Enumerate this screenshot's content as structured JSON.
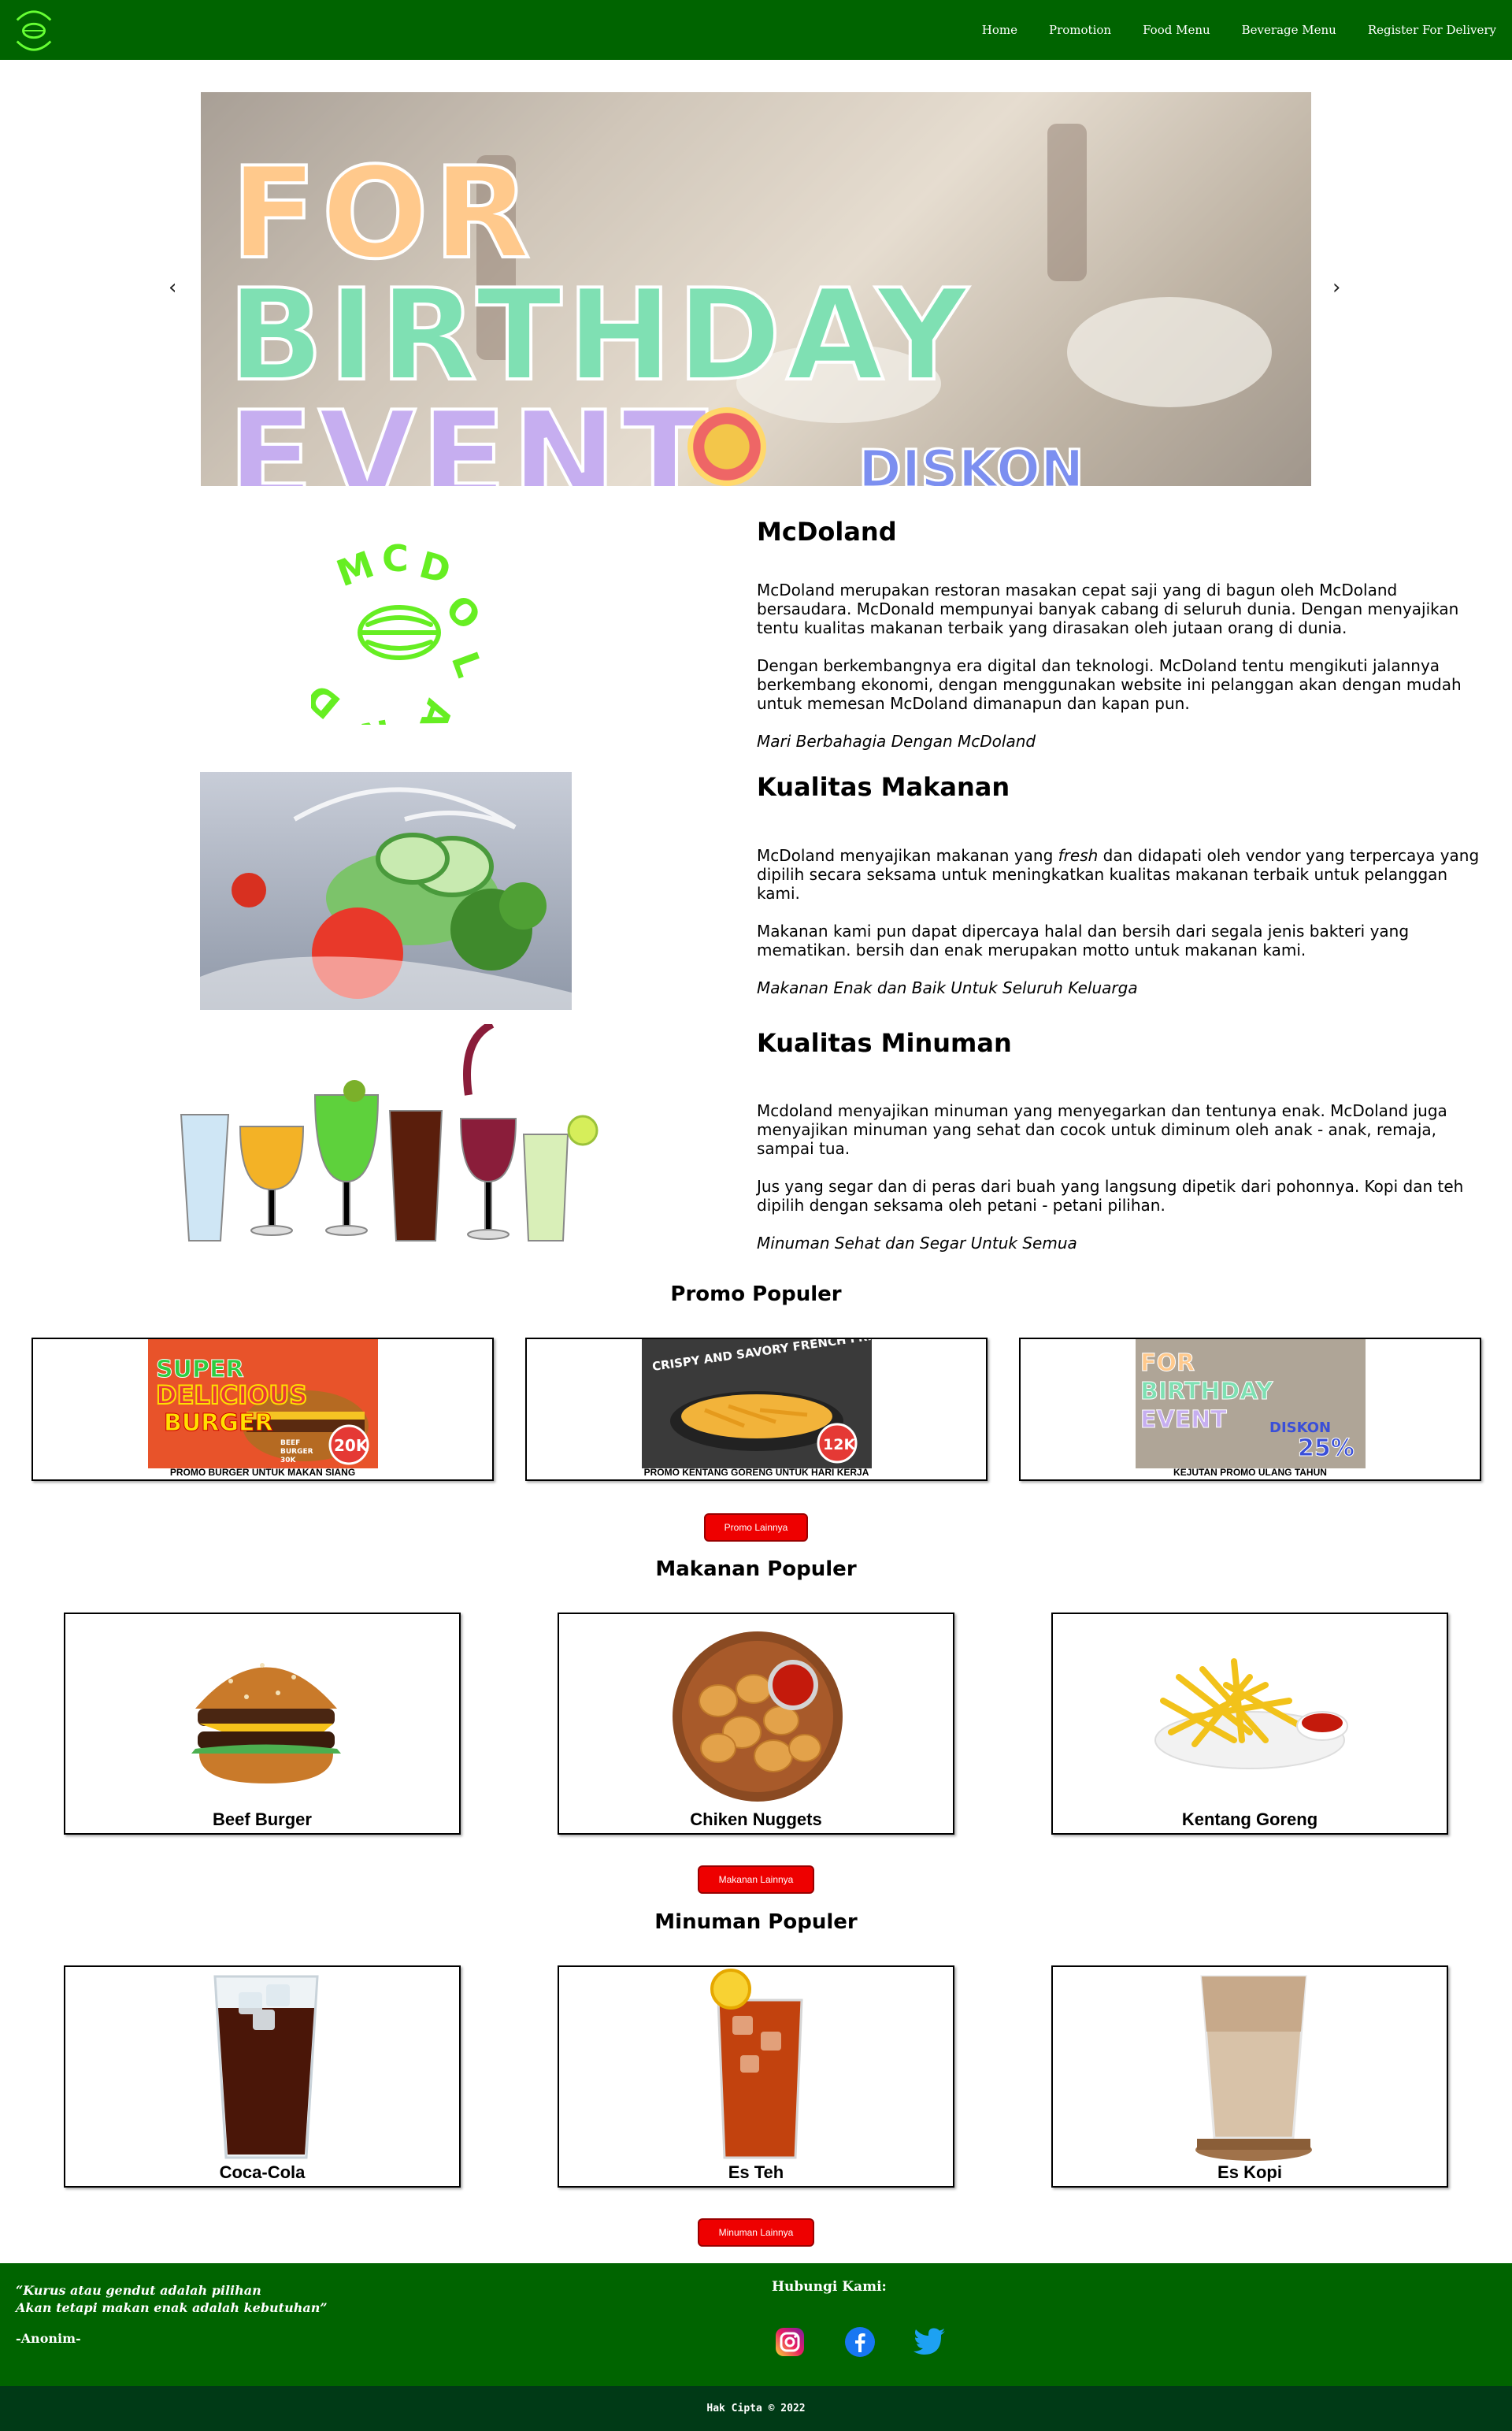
{
  "nav": {
    "logo_alt": "McDoland",
    "links": [
      "Home",
      "Promotion",
      "Food Menu",
      "Beverage Menu",
      "Register For Delivery"
    ]
  },
  "hero": {
    "prev": "‹",
    "next": "›",
    "line1": "FOR",
    "line2": "BIRTHDAY",
    "line3": "EVENT",
    "diskon": "DISKON"
  },
  "about": [
    {
      "title": "McDoland",
      "paragraphs": [
        "McDoland merupakan restoran masakan cepat saji yang di bagun oleh McDoland bersaudara. McDonald mempunyai banyak cabang di seluruh dunia. Dengan menyajikan tentu kualitas makanan terbaik yang dirasakan oleh jutaan orang di dunia.",
        "Dengan berkembangnya era digital dan teknologi. McDoland tentu mengikuti jalannya berkembang ekonomi, dengan menggunakan website ini pelanggan akan dengan mudah untuk memesan McDoland dimanapun dan kapan pun."
      ],
      "tagline": "Mari Berbahagia Dengan McDoland"
    },
    {
      "title": "Kualitas Makanan",
      "p1_before": "McDoland menyajikan makanan yang ",
      "p1_em": "fresh",
      "p1_after": " dan didapati oleh vendor yang terpercaya yang dipilih secara seksama untuk meningkatkan kualitas makanan terbaik untuk pelanggan kami.",
      "p2": "Makanan kami pun dapat dipercaya halal dan bersih dari segala jenis bakteri yang mematikan. bersih dan enak merupakan motto untuk makanan kami.",
      "tagline": "Makanan Enak dan Baik Untuk Seluruh Keluarga"
    },
    {
      "title": "Kualitas Minuman",
      "paragraphs": [
        "Mcdoland menyajikan minuman yang menyegarkan dan tentunya enak. McDoland juga menyajikan minuman yang sehat dan cocok untuk diminum oleh anak - anak, remaja, sampai tua.",
        "Jus yang segar dan di peras dari buah yang langsung dipetik dari pohonnya. Kopi dan teh dipilih dengan seksama oleh petani - petani pilihan."
      ],
      "tagline": "Minuman Sehat dan Segar Untuk Semua"
    }
  ],
  "promo": {
    "title": "Promo Populer",
    "items": [
      {
        "caption": "PROMO BURGER UNTUK MAKAN SIANG",
        "banner_l1": "SUPER",
        "banner_l2": "DELICIOUS",
        "banner_l3": "BURGER",
        "price": "20K",
        "sub1": "BEEF",
        "sub2": "BURGER",
        "sub3": "30K"
      },
      {
        "caption": "PROMO KENTANG GORENG UNTUK HARI KERJA",
        "banner_l1": "CRISPY AND SAVORY FRENCH FRIES",
        "price": "12K"
      },
      {
        "caption": "KEJUTAN PROMO ULANG TAHUN",
        "banner_l1": "FOR",
        "banner_l2": "BIRTHDAY",
        "banner_l3": "EVENT",
        "diskon": "DISKON",
        "price": "25%"
      }
    ],
    "button": "Promo Lainnya"
  },
  "food": {
    "title": "Makanan Populer",
    "items": [
      "Beef Burger",
      "Chiken Nuggets",
      "Kentang Goreng"
    ],
    "button": "Makanan Lainnya"
  },
  "drinks": {
    "title": "Minuman Populer",
    "items": [
      "Coca-Cola",
      "Es Teh",
      "Es Kopi"
    ],
    "button": "Minuman Lainnya"
  },
  "footer": {
    "quote_l1": "“Kurus atau gendut adalah pilihan",
    "quote_l2": "Akan tetapi makan enak adalah kebutuhan”",
    "author": "-Anonim-",
    "contact_title": "Hubungi Kami:",
    "copyright": "Hak Cipta ©  2022"
  },
  "colors": {
    "nav": "#006400",
    "footer_bottom": "#003a16",
    "button": "#ee0000",
    "logo": "#66ff33"
  }
}
